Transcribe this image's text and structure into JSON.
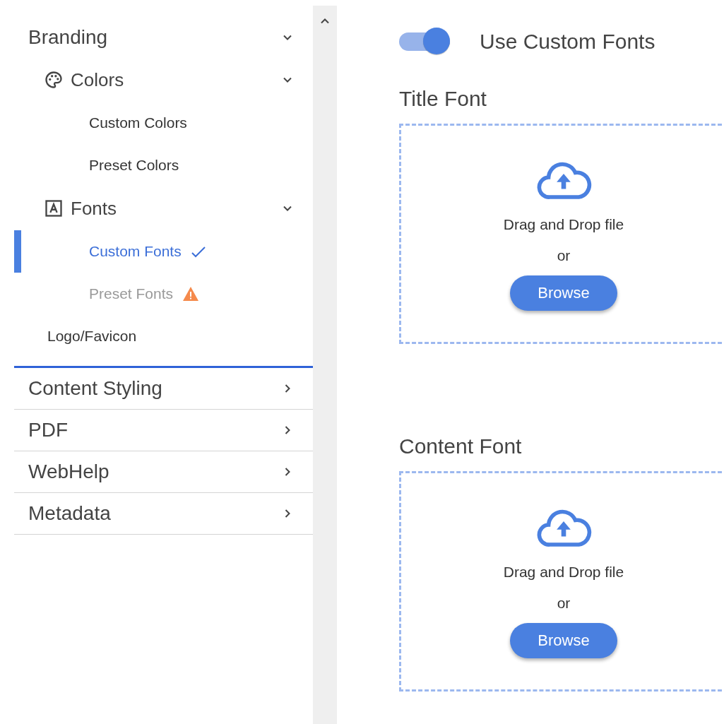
{
  "sidebar": {
    "sections": [
      {
        "label": "Branding",
        "expanded": true,
        "children": [
          {
            "label": "Colors",
            "kind": "palette",
            "expanded": true,
            "children": [
              {
                "label": "Custom Colors",
                "selected": false,
                "kind": "plain"
              },
              {
                "label": "Preset Colors",
                "selected": false,
                "kind": "plain"
              }
            ]
          },
          {
            "label": "Fonts",
            "kind": "font",
            "expanded": true,
            "children": [
              {
                "label": "Custom Fonts",
                "selected": true,
                "kind": "done"
              },
              {
                "label": "Preset Fonts",
                "selected": false,
                "kind": "warning"
              }
            ]
          },
          {
            "label": "Logo/Favicon",
            "kind": "link"
          }
        ]
      },
      {
        "label": "Content Styling",
        "expanded": false
      },
      {
        "label": "PDF",
        "expanded": false
      },
      {
        "label": "WebHelp",
        "expanded": false
      },
      {
        "label": "Metadata",
        "expanded": false
      }
    ]
  },
  "main": {
    "toggle": {
      "label": "Use Custom Fonts",
      "on": true
    },
    "uploads": [
      {
        "title": "Title Font",
        "hint": "Drag and Drop file",
        "or": "or",
        "button": "Browse"
      },
      {
        "title": "Content Font",
        "hint": "Drag and Drop file",
        "or": "or",
        "button": "Browse"
      }
    ]
  }
}
